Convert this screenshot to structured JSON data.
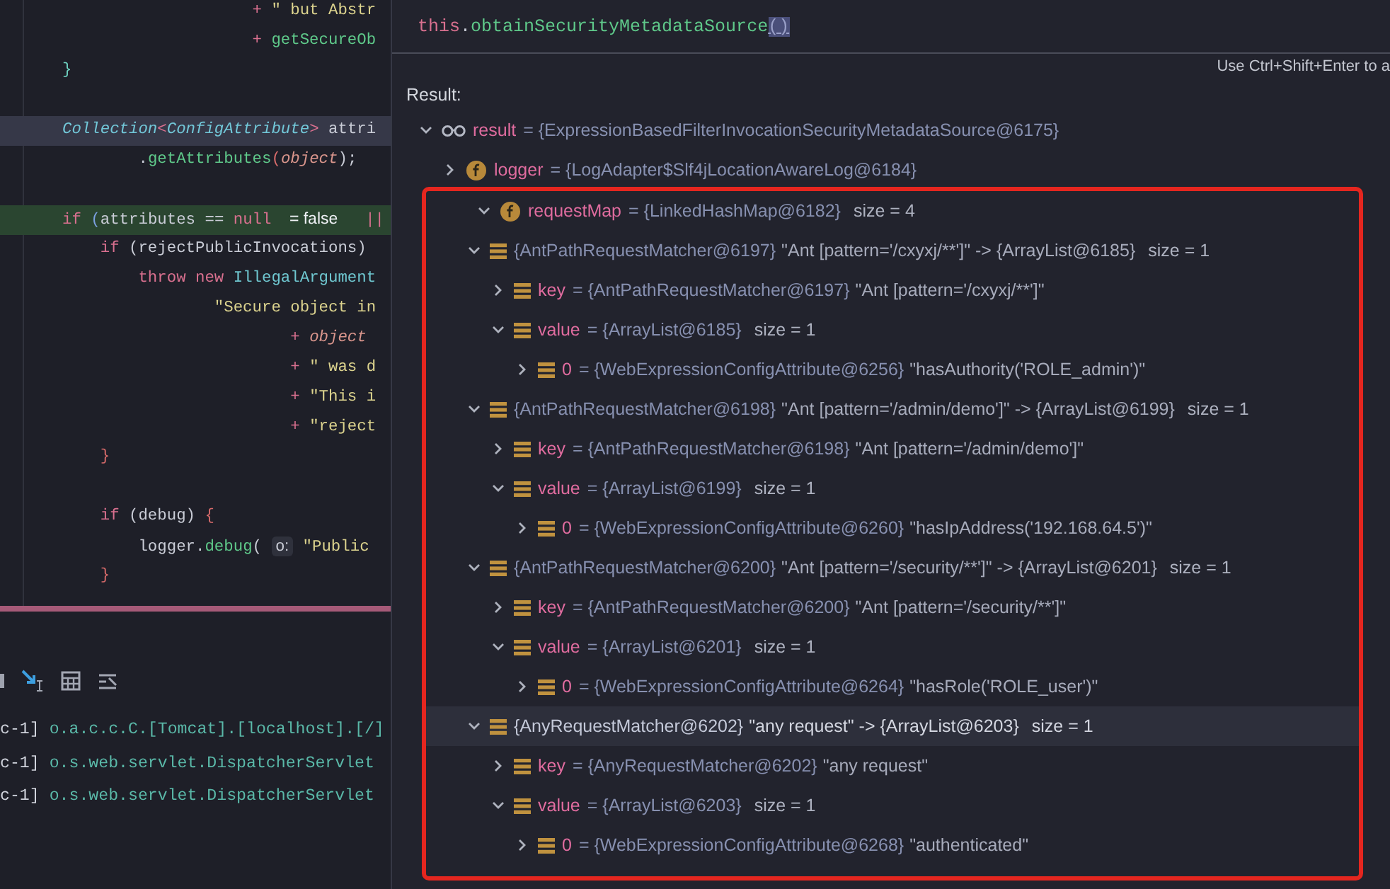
{
  "editor": {
    "lines": [
      {
        "kind": "plain",
        "tokens": [
          {
            "text": "                    + ",
            "kind": "operator"
          },
          {
            "text": "\" but Abstr",
            "kind": "string"
          }
        ]
      },
      {
        "kind": "plain",
        "tokens": [
          {
            "text": "                    + ",
            "kind": "operator"
          },
          {
            "text": "getSecureOb",
            "kind": "method"
          }
        ]
      },
      {
        "kind": "plain",
        "tokens": [
          {
            "text": "}",
            "kind": "brace-a"
          }
        ]
      },
      {
        "kind": "plain"
      },
      {
        "kind": "caret",
        "tokens": [
          {
            "text": "Collection",
            "kind": "type"
          },
          {
            "text": "<",
            "kind": "operator"
          },
          {
            "text": "ConfigAttribute",
            "kind": "type"
          },
          {
            "text": ">",
            "kind": "operator"
          },
          {
            "text": " attri",
            "kind": "plain"
          }
        ]
      },
      {
        "kind": "plain",
        "tokens": [
          {
            "text": "        .",
            "kind": "plain"
          },
          {
            "text": "getAttributes",
            "kind": "method"
          },
          {
            "text": "(",
            "kind": "brace-b"
          },
          {
            "text": "object",
            "kind": "field"
          },
          {
            "text": ");",
            "kind": "plain"
          }
        ]
      },
      {
        "kind": "plain"
      },
      {
        "kind": "execution",
        "tokens": [
          {
            "text": "if ",
            "kind": "keyword"
          },
          {
            "text": "(",
            "kind": "brace-c"
          },
          {
            "text": "attributes == ",
            "kind": "plain"
          },
          {
            "text": "null ",
            "kind": "keyword"
          },
          {
            "text": "= false",
            "kind": "inlay"
          },
          {
            "text": "  ||",
            "kind": "operator"
          }
        ]
      },
      {
        "kind": "plain",
        "tokens": [
          {
            "text": "    if ",
            "kind": "keyword"
          },
          {
            "text": "(rejectPublicInvocations)",
            "kind": "plain"
          }
        ]
      },
      {
        "kind": "plain",
        "tokens": [
          {
            "text": "        throw new ",
            "kind": "keyword"
          },
          {
            "text": "IllegalArgument",
            "kind": "class"
          }
        ]
      },
      {
        "kind": "plain",
        "tokens": [
          {
            "text": "                \"Secure object in",
            "kind": "string"
          }
        ]
      },
      {
        "kind": "plain",
        "tokens": [
          {
            "text": "                        + ",
            "kind": "operator"
          },
          {
            "text": "object",
            "kind": "field"
          }
        ]
      },
      {
        "kind": "plain",
        "tokens": [
          {
            "text": "                        + ",
            "kind": "operator"
          },
          {
            "text": "\" was d",
            "kind": "string"
          }
        ]
      },
      {
        "kind": "plain",
        "tokens": [
          {
            "text": "                        + ",
            "kind": "operator"
          },
          {
            "text": "\"This i",
            "kind": "string"
          }
        ]
      },
      {
        "kind": "plain",
        "tokens": [
          {
            "text": "                        + ",
            "kind": "operator"
          },
          {
            "text": "\"reject",
            "kind": "string"
          }
        ]
      },
      {
        "kind": "plain",
        "tokens": [
          {
            "text": "    }",
            "kind": "brace-b"
          }
        ]
      },
      {
        "kind": "plain"
      },
      {
        "kind": "plain",
        "tokens": [
          {
            "text": "    if ",
            "kind": "keyword"
          },
          {
            "text": "(debug) ",
            "kind": "plain"
          },
          {
            "text": "{",
            "kind": "brace-b"
          }
        ]
      },
      {
        "kind": "plain",
        "tokens": [
          {
            "text": "        logger.",
            "kind": "plain"
          },
          {
            "text": "debug",
            "kind": "method"
          },
          {
            "text": "( ",
            "kind": "plain"
          },
          {
            "text": "o:",
            "kind": "param-hint"
          },
          {
            "text": " \"Public",
            "kind": "string"
          }
        ]
      },
      {
        "kind": "plain",
        "tokens": [
          {
            "text": "    }",
            "kind": "brace-b"
          }
        ]
      }
    ]
  },
  "console": {
    "log_lines": [
      {
        "thread": "c-1]",
        "logger": "o.a.c.c.C.[Tomcat].[localhost].[/]"
      },
      {
        "thread": "c-1]",
        "logger": "o.s.web.servlet.DispatcherServlet"
      },
      {
        "thread": "c-1]",
        "logger": "o.s.web.servlet.DispatcherServlet"
      }
    ]
  },
  "evaluate": {
    "expression": [
      {
        "text": "this",
        "kind": "keyword"
      },
      {
        "text": ".",
        "kind": "plain"
      },
      {
        "text": "obtainSecurityMetadataSource",
        "kind": "method"
      },
      {
        "text": "()",
        "kind": "brace-match"
      }
    ],
    "hint": "Use Ctrl+Shift+Enter to a",
    "result_label": "Result:",
    "tree": [
      {
        "kind": "watch",
        "name": "result",
        "ref": "= {ExpressionBasedFilterInvocationSecurityMetadataSource@6175}",
        "expanded": true,
        "selected": false,
        "outlined": false,
        "children": [
          {
            "kind": "field",
            "name": "logger",
            "ref": "= {LogAdapter$Slf4jLocationAwareLog@6184}",
            "expanded": false,
            "selected": false,
            "outlined": false
          },
          {
            "kind": "field",
            "name": "requestMap",
            "ref": "= {LinkedHashMap@6182}",
            "size": "size = 4",
            "expanded": true,
            "selected": false,
            "outlined": true,
            "children": [
              {
                "kind": "entry",
                "ref": "{AntPathRequestMatcher@6197}",
                "detail": "\"Ant [pattern='/cxyxj/**']\" -> {ArrayList@6185}",
                "size": "size = 1",
                "expanded": true,
                "selected": false,
                "outlined": false,
                "children": [
                  {
                    "kind": "entry",
                    "name": "key",
                    "ref": "= {AntPathRequestMatcher@6197}",
                    "detail": "\"Ant [pattern='/cxyxj/**']\"",
                    "expanded": false,
                    "selected": false,
                    "outlined": false
                  },
                  {
                    "kind": "entry",
                    "name": "value",
                    "ref": "= {ArrayList@6185}",
                    "size": "size = 1",
                    "expanded": true,
                    "selected": false,
                    "outlined": false,
                    "children": [
                      {
                        "kind": "entry",
                        "name": "0",
                        "ref": "= {WebExpressionConfigAttribute@6256}",
                        "detail": "\"hasAuthority('ROLE_admin')\"",
                        "expanded": false,
                        "selected": false,
                        "outlined": false
                      }
                    ]
                  }
                ]
              },
              {
                "kind": "entry",
                "ref": "{AntPathRequestMatcher@6198}",
                "detail": "\"Ant [pattern='/admin/demo']\" -> {ArrayList@6199}",
                "size": "size = 1",
                "expanded": true,
                "selected": false,
                "outlined": false,
                "children": [
                  {
                    "kind": "entry",
                    "name": "key",
                    "ref": "= {AntPathRequestMatcher@6198}",
                    "detail": "\"Ant [pattern='/admin/demo']\"",
                    "expanded": false,
                    "selected": false,
                    "outlined": false
                  },
                  {
                    "kind": "entry",
                    "name": "value",
                    "ref": "= {ArrayList@6199}",
                    "size": "size = 1",
                    "expanded": true,
                    "selected": false,
                    "outlined": false,
                    "children": [
                      {
                        "kind": "entry",
                        "name": "0",
                        "ref": "= {WebExpressionConfigAttribute@6260}",
                        "detail": "\"hasIpAddress('192.168.64.5')\"",
                        "expanded": false,
                        "selected": false,
                        "outlined": false
                      }
                    ]
                  }
                ]
              },
              {
                "kind": "entry",
                "ref": "{AntPathRequestMatcher@6200}",
                "detail": "\"Ant [pattern='/security/**']\" -> {ArrayList@6201}",
                "size": "size = 1",
                "expanded": true,
                "selected": false,
                "outlined": false,
                "children": [
                  {
                    "kind": "entry",
                    "name": "key",
                    "ref": "= {AntPathRequestMatcher@6200}",
                    "detail": "\"Ant [pattern='/security/**']\"",
                    "expanded": false,
                    "selected": false,
                    "outlined": false
                  },
                  {
                    "kind": "entry",
                    "name": "value",
                    "ref": "= {ArrayList@6201}",
                    "size": "size = 1",
                    "expanded": true,
                    "selected": false,
                    "outlined": false,
                    "children": [
                      {
                        "kind": "entry",
                        "name": "0",
                        "ref": "= {WebExpressionConfigAttribute@6264}",
                        "detail": "\"hasRole('ROLE_user')\"",
                        "expanded": false,
                        "selected": false,
                        "outlined": false
                      }
                    ]
                  }
                ]
              },
              {
                "kind": "entry",
                "ref": "{AnyRequestMatcher@6202}",
                "detail": "\"any request\" -> {ArrayList@6203}",
                "size": "size = 1",
                "expanded": true,
                "selected": true,
                "outlined": false,
                "children": [
                  {
                    "kind": "entry",
                    "name": "key",
                    "ref": "= {AnyRequestMatcher@6202}",
                    "detail": "\"any request\"",
                    "expanded": false,
                    "selected": false,
                    "outlined": false
                  },
                  {
                    "kind": "entry",
                    "name": "value",
                    "ref": "= {ArrayList@6203}",
                    "size": "size = 1",
                    "expanded": true,
                    "selected": false,
                    "outlined": false,
                    "children": [
                      {
                        "kind": "entry",
                        "name": "0",
                        "ref": "= {WebExpressionConfigAttribute@6268}",
                        "detail": "\"authenticated\"",
                        "expanded": false,
                        "selected": false,
                        "outlined": false
                      }
                    ]
                  }
                ]
              }
            ]
          }
        ]
      }
    ]
  }
}
